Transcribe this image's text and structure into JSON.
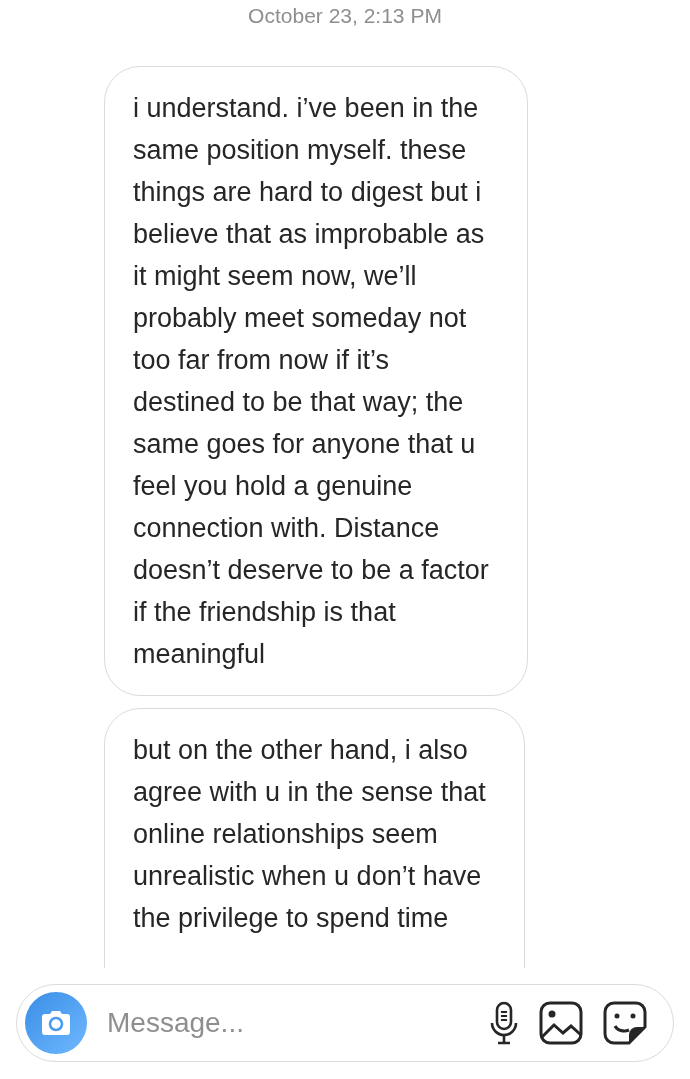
{
  "timestamp": "October 23, 2:13 PM",
  "messages": [
    {
      "kind": "received",
      "text": "i understand. i’ve been in the\nsame position myself. these\nthings are hard to digest but i\nbelieve that as improbable as\nit might seem now, we’ll\nprobably meet someday not\ntoo far from now if it’s\ndestined to be that way; the\nsame goes for anyone that u\nfeel you hold a genuine\nconnection with. Distance\ndoesn’t deserve to be a factor\nif the friendship is that\nmeaningful"
    },
    {
      "kind": "received",
      "text": "but on the other hand, i also\nagree with u in the sense that\nonline relationships seem\nunrealistic when u don’t have\nthe privilege to spend time"
    }
  ],
  "composer": {
    "placeholder": "Message..."
  }
}
